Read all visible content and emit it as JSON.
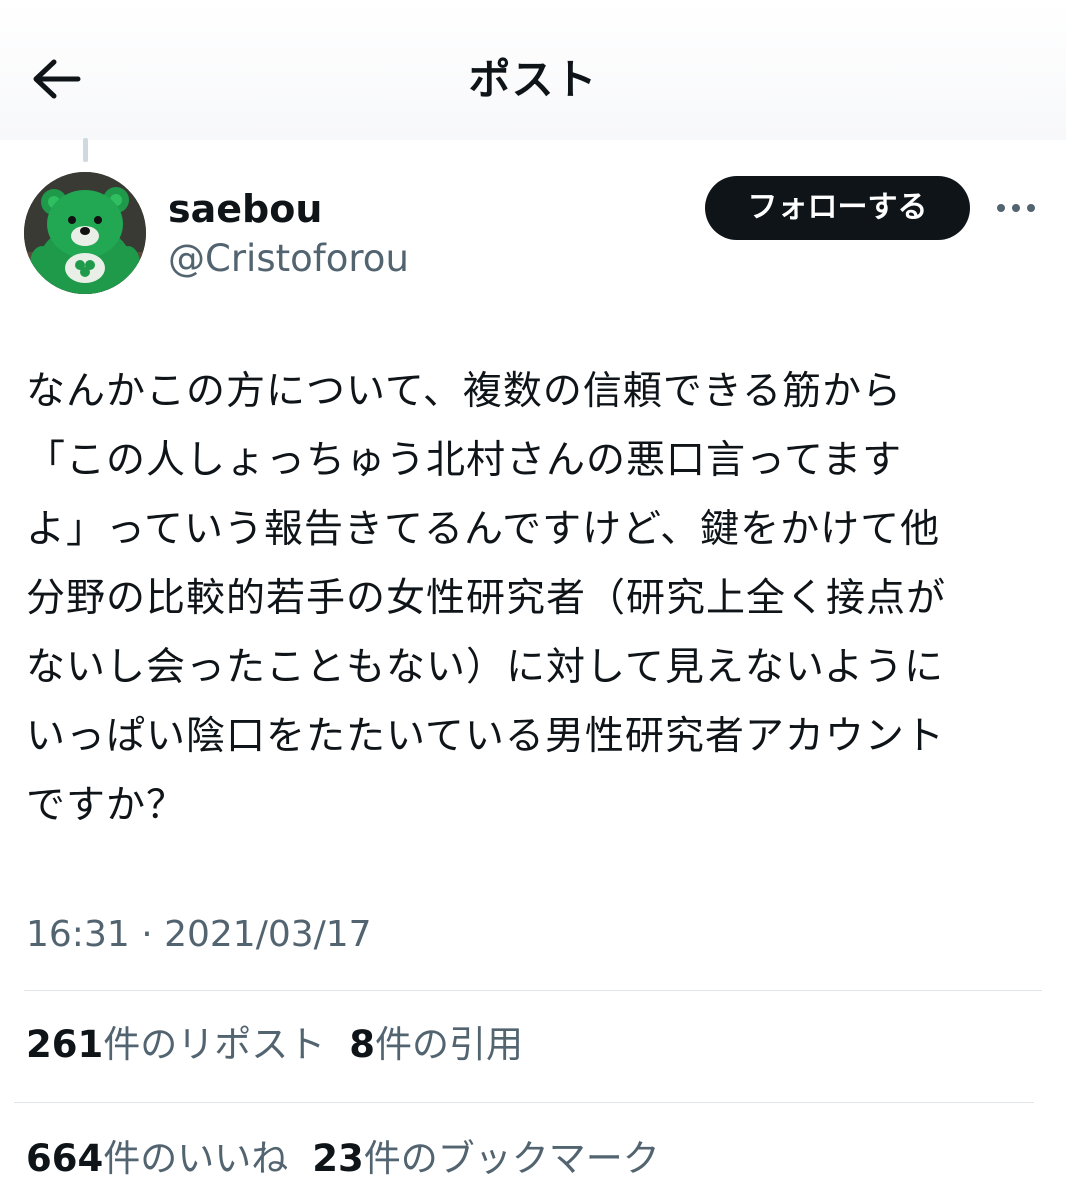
{
  "header": {
    "title": "ポスト",
    "back_icon": "arrow-left-icon"
  },
  "author": {
    "display_name": "saebou",
    "handle": "@Cristoforou",
    "avatar_icon": "green-bear-avatar"
  },
  "actions": {
    "follow_label": "フォローする",
    "more_icon": "more-dots-icon"
  },
  "post": {
    "text": "なんかこの方について、複数の信頼できる筋から\n「この人しょっちゅう北村さんの悪口言ってます\nよ」っていう報告きてるんですけど、鍵をかけて他\n分野の比較的若手の女性研究者（研究上全く接点が\nないし会ったこともない）に対して見えないように\nいっぱい陰口をたたいている男性研究者アカウント\nですか？",
    "timestamp": "16:31 · 2021/03/17"
  },
  "stats": {
    "reposts_count": "261",
    "reposts_label": "件のリポスト",
    "quotes_count": "8",
    "quotes_label": "件の引用",
    "likes_count": "664",
    "likes_label": "件のいいね",
    "bookmarks_count": "23",
    "bookmarks_label": "件のブックマーク"
  },
  "colors": {
    "text_primary": "#0f1419",
    "text_secondary": "#536471",
    "divider": "#dfe5e9",
    "follow_button_bg": "#0f1419"
  }
}
